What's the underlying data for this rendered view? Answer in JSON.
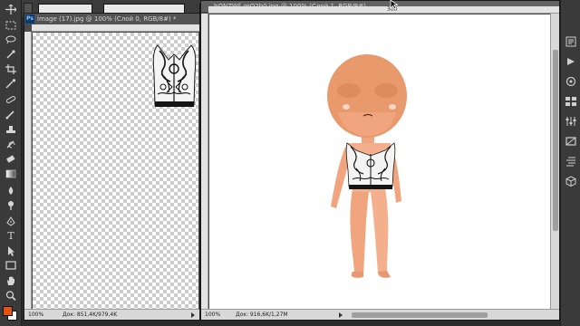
{
  "left_document": {
    "title": "image (17).jpg @ 100% (Слой 0, RGB/8#) *",
    "status_zoom": "100%",
    "status_doc": "Док: 851,4K/979,4K"
  },
  "right_document": {
    "title": "bQNZWf_mQ2b0.jpg @ 100% (Слой 1, RGB/8#)",
    "ruler_label": "300",
    "status_zoom": "100%",
    "status_doc": "Док: 916,6K/1,27M"
  },
  "toolbar": {
    "tools": [
      "move-tool",
      "marquee-tool",
      "lasso-tool",
      "quick-select-tool",
      "crop-tool",
      "eyedropper-tool",
      "healing-tool",
      "brush-tool",
      "clone-stamp-tool",
      "history-brush-tool",
      "eraser-tool",
      "gradient-tool",
      "blur-tool",
      "dodge-tool",
      "pen-tool",
      "type-tool",
      "path-select-tool",
      "shape-tool",
      "hand-tool",
      "zoom-tool"
    ]
  },
  "colors": {
    "foreground": "#e8520f",
    "background": "#ffffff",
    "skin": "#f0a57e",
    "head": "#e89a6c"
  }
}
